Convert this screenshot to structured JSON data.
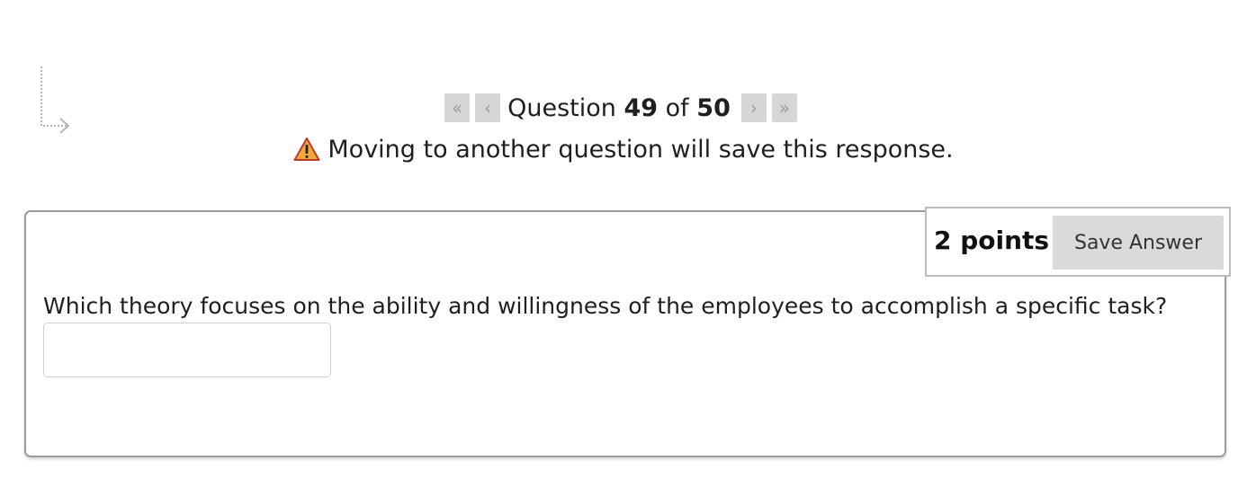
{
  "navigation": {
    "first_icon": "double-chevron-left-icon",
    "prev_icon": "chevron-left-icon",
    "next_icon": "chevron-right-icon",
    "last_icon": "double-chevron-right-icon",
    "first_glyph": "«",
    "prev_glyph": "‹",
    "next_glyph": "›",
    "last_glyph": "»",
    "question_word": "Question",
    "current": "49",
    "of_word": "of",
    "total": "50"
  },
  "notice": {
    "icon": "warning-icon",
    "text": "Moving to another question will save this response."
  },
  "question": {
    "points_label": "2 points",
    "save_button_label": "Save Answer",
    "prompt": "Which theory focuses on the ability and willingness of the employees to accomplish a specific task?",
    "answer_value": ""
  },
  "colors": {
    "nav_button_bg": "#d6d6d6",
    "warning_fill": "#f2a93b",
    "warning_border": "#c0392b",
    "card_border": "#9c9c9c"
  }
}
